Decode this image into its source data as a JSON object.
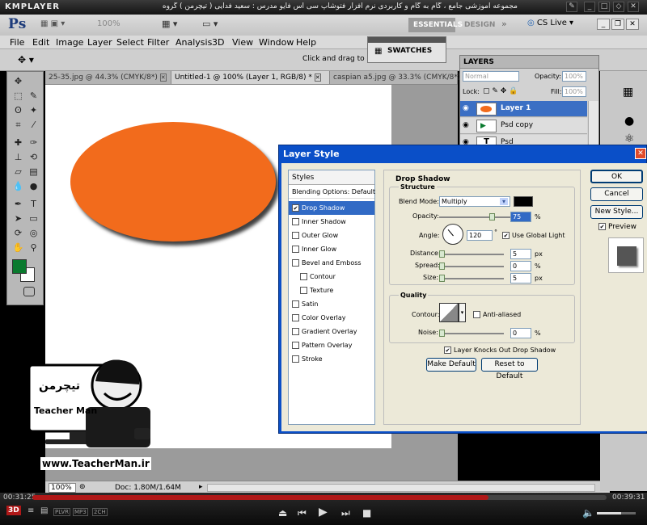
{
  "player": {
    "app_name": "KMPLAYER",
    "movie_title": "مجموعه آموزشی جامع ، گام به گام و کاربردی نرم افزار فتوشاپ سی اس فایو  مدرس : سعید فدایی ( تیچرمن ) گروه آموزشی پادشاه گرافیست ها",
    "elapsed": "00:31:25",
    "total": "00:39:31",
    "progress_fraction": 0.795,
    "mode_labels": [
      "3D",
      "PLVR",
      "MP3",
      "2CH"
    ]
  },
  "photoshop": {
    "logo": "Ps",
    "workspace_buttons": [
      "ESSENTIALS",
      "DESIGN"
    ],
    "cs_live": "CS Live",
    "menu": [
      "File",
      "Edit",
      "Image",
      "Layer",
      "Select",
      "Filter",
      "Analysis",
      "3D",
      "View",
      "Window",
      "Help"
    ],
    "zoom_combo": "100%",
    "option_hint": "Click and drag to repo",
    "swatches_label": "SWATCHES",
    "tabs": [
      {
        "label": "25-35.jpg @ 44.3% (CMYK/8*)",
        "active": false
      },
      {
        "label": "Untitled-1 @ 100% (Layer 1, RGB/8) *",
        "active": true
      },
      {
        "label": "caspian a5.jpg @ 33.3% (CMYK/8*)",
        "active": false
      }
    ],
    "status_zoom": "100%",
    "status_doc": "Doc: 1.80M/1.64M",
    "foreground_color": "#0a7a2e",
    "shape_color": "#f26b1c"
  },
  "layers_panel": {
    "title": "LAYERS",
    "blend": "Normal",
    "opacity_label": "Opacity:",
    "opacity_value": "100%",
    "lock_label": "Lock:",
    "fill_label": "Fill:",
    "fill_value": "100%",
    "layers": [
      {
        "name": "Layer 1",
        "selected": true
      },
      {
        "name": "Psd copy",
        "selected": false
      },
      {
        "name": "Psd",
        "selected": false
      }
    ]
  },
  "dialog": {
    "title": "Layer Style",
    "styles_header": "Styles",
    "blending_options": "Blending Options: Default",
    "styles": [
      {
        "label": "Drop Shadow",
        "checked": true,
        "selected": true,
        "indent": false
      },
      {
        "label": "Inner Shadow",
        "checked": false,
        "selected": false,
        "indent": false
      },
      {
        "label": "Outer Glow",
        "checked": false,
        "selected": false,
        "indent": false
      },
      {
        "label": "Inner Glow",
        "checked": false,
        "selected": false,
        "indent": false
      },
      {
        "label": "Bevel and Emboss",
        "checked": false,
        "selected": false,
        "indent": false
      },
      {
        "label": "Contour",
        "checked": false,
        "selected": false,
        "indent": true
      },
      {
        "label": "Texture",
        "checked": false,
        "selected": false,
        "indent": true
      },
      {
        "label": "Satin",
        "checked": false,
        "selected": false,
        "indent": false
      },
      {
        "label": "Color Overlay",
        "checked": false,
        "selected": false,
        "indent": false
      },
      {
        "label": "Gradient Overlay",
        "checked": false,
        "selected": false,
        "indent": false
      },
      {
        "label": "Pattern Overlay",
        "checked": false,
        "selected": false,
        "indent": false
      },
      {
        "label": "Stroke",
        "checked": false,
        "selected": false,
        "indent": false
      }
    ],
    "section_title": "Drop Shadow",
    "structure_title": "Structure",
    "blend_mode_label": "Blend Mode:",
    "blend_mode_value": "Multiply",
    "shadow_color": "#000000",
    "opacity_label": "Opacity:",
    "opacity_value": "75",
    "opacity_fraction": 0.75,
    "angle_label": "Angle:",
    "angle_value": "120",
    "degree_sign": "°",
    "use_global_light": "Use Global Light",
    "distance_label": "Distance:",
    "distance_value": "5",
    "spread_label": "Spread:",
    "spread_value": "0",
    "size_label": "Size:",
    "size_value": "5",
    "px": "px",
    "pct": "%",
    "quality_title": "Quality",
    "contour_label": "Contour:",
    "anti_aliased": "Anti-aliased",
    "noise_label": "Noise:",
    "noise_value": "0",
    "knocks_out": "Layer Knocks Out Drop Shadow",
    "make_default": "Make Default",
    "reset_default": "Reset to Default",
    "ok": "OK",
    "cancel": "Cancel",
    "new_style": "New Style...",
    "preview": "Preview"
  },
  "watermark": {
    "name": "Teacher Man",
    "url": "www.TeacherMan.ir"
  }
}
